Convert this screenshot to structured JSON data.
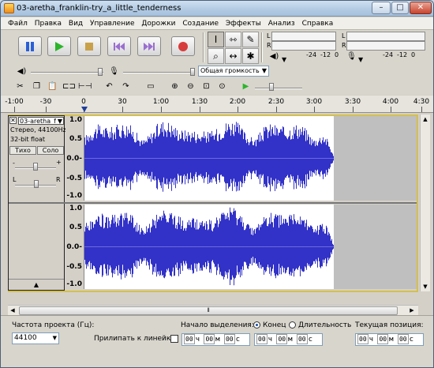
{
  "window": {
    "title": "03-aretha_franklin-try_a_little_tenderness",
    "controls": {
      "minimize": "–",
      "maximize": "□",
      "close": "✕"
    }
  },
  "menu": [
    "Файл",
    "Правка",
    "Вид",
    "Управление",
    "Дорожки",
    "Создание",
    "Эффекты",
    "Анализ",
    "Справка"
  ],
  "transport": {
    "buttons": [
      {
        "name": "pause",
        "icon": "pause-icon"
      },
      {
        "name": "play",
        "icon": "play-icon"
      },
      {
        "name": "stop",
        "icon": "stop-icon"
      },
      {
        "name": "skip-start",
        "icon": "skip-start-icon"
      },
      {
        "name": "skip-end",
        "icon": "skip-end-icon"
      },
      {
        "name": "record",
        "icon": "record-icon"
      }
    ],
    "colors": {
      "pause": "#2a5fd6",
      "play": "#2bb52b",
      "stop": "#c8a14a",
      "skip": "#9a6fd0",
      "record": "#d83b3b"
    }
  },
  "tools": [
    "I",
    "⇿",
    "✎",
    "⌕",
    "↔",
    "✱"
  ],
  "meters": {
    "L": "L",
    "R": "R",
    "ticks": [
      "-24",
      "-12",
      "0"
    ]
  },
  "mixer": {
    "volume_select": "Общая громкость"
  },
  "ruler": {
    "labels": [
      "-1:00",
      "-30",
      "0",
      "30",
      "1:00",
      "1:30",
      "2:00",
      "2:30",
      "3:00",
      "3:30",
      "4:00",
      "4:30"
    ]
  },
  "track": {
    "name": "03-aretha_f",
    "info1": "Стерео, 44100Hz",
    "info2": "32-bit float",
    "mute": "Тихо",
    "solo": "Соло",
    "gain_minus": "-",
    "gain_plus": "+",
    "pan_l": "L",
    "pan_r": "R",
    "scale": [
      "1.0",
      "0.5",
      "0.0-",
      "-0.5",
      "-1.0"
    ],
    "wave_color": "#3232c8"
  },
  "status": {
    "rate_label": "Частота проекта (Гц):",
    "rate_value": "44100",
    "snap_label": "Прилипать к линейке",
    "sel_start_label": "Начало выделения:",
    "end_label": "Конец",
    "length_label": "Длительность",
    "position_label": "Текущая позиция:",
    "time_value": [
      "00",
      "ч",
      "00",
      "м",
      "00",
      "с"
    ]
  }
}
